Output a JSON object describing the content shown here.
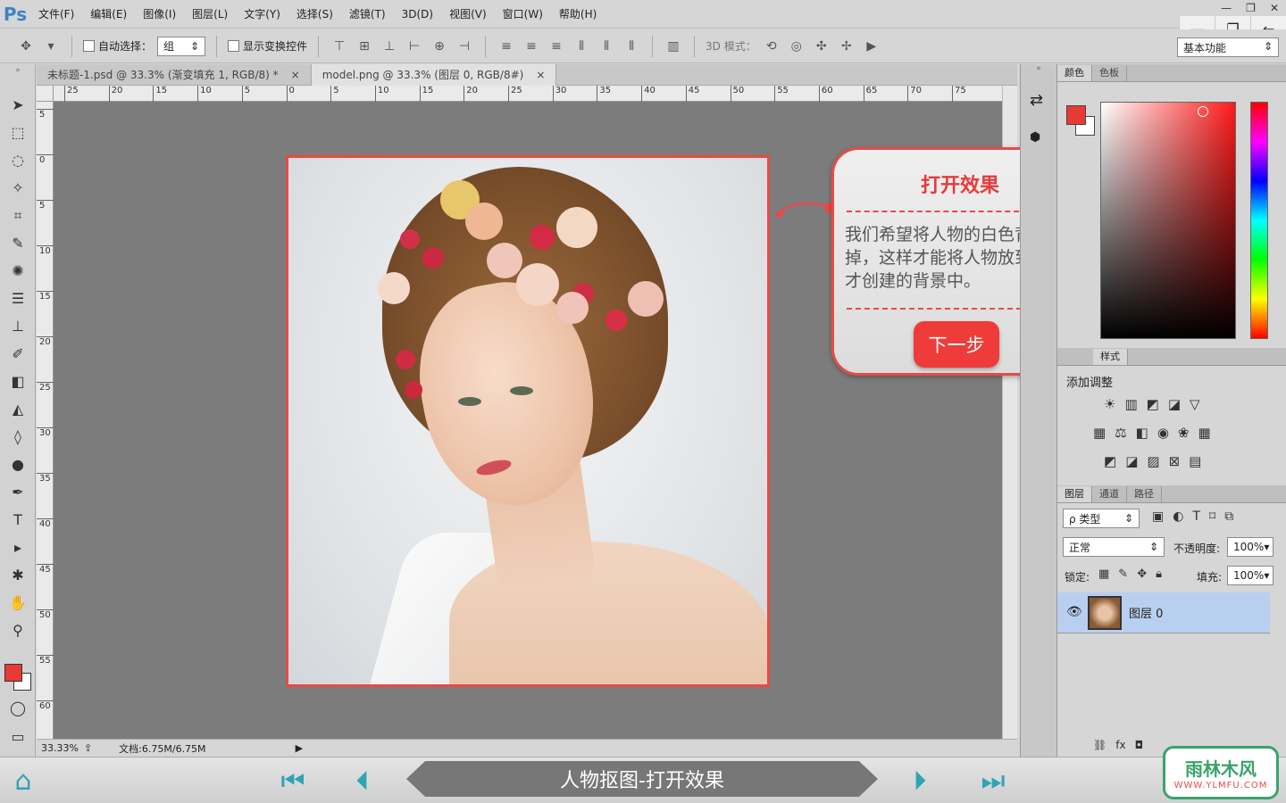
{
  "menubar": {
    "logo": "Ps",
    "items": [
      "文件(F)",
      "编辑(E)",
      "图像(I)",
      "图层(L)",
      "文字(Y)",
      "选择(S)",
      "滤镜(T)",
      "3D(D)",
      "视图(V)",
      "窗口(W)",
      "帮助(H)"
    ]
  },
  "options": {
    "auto_select_label": "自动选择：",
    "auto_select_value": "组",
    "show_transform_label": "显示变换控件",
    "mode_3d_label": "3D 模式：",
    "workspace": "基本功能"
  },
  "doc_tabs": [
    {
      "label": "未标题-1.psd @ 33.3% (渐变填充 1, RGB/8) *",
      "close": "×"
    },
    {
      "label": "model.png @ 33.3% (图层 0, RGB/8#)",
      "close": "×"
    }
  ],
  "ruler": {
    "h_ticks": [
      "25",
      "20",
      "15",
      "10",
      "5",
      "0",
      "5",
      "10",
      "15",
      "20",
      "25",
      "30",
      "35",
      "40",
      "45",
      "50",
      "55",
      "60",
      "65",
      "70",
      "75"
    ],
    "v_ticks": [
      "5",
      "0",
      "5",
      "10",
      "15",
      "20",
      "25",
      "30",
      "35",
      "40",
      "45",
      "50",
      "55",
      "60"
    ]
  },
  "status": {
    "zoom": "33.33%",
    "doc_size": "文档:6.75M/6.75M"
  },
  "callout": {
    "title": "打开效果",
    "body": "我们希望将人物的白色背景去掉，这样才能将人物放到我们刚才创建的背景中。",
    "button": "下一步"
  },
  "panels": {
    "color_tabs": [
      "颜色",
      "色板"
    ],
    "style_tabs": [
      "样式"
    ],
    "adjust_label": "添加调整",
    "layer_tabs": [
      "图层",
      "通道",
      "路径"
    ],
    "filter_kind": "ρ 类型",
    "blend_mode": "正常",
    "opacity_label": "不透明度:",
    "opacity_value": "100%",
    "lock_label": "锁定:",
    "fill_label": "填充:",
    "fill_value": "100%",
    "layer_name": "图层 0"
  },
  "nav": {
    "title": "人物抠图-打开效果"
  },
  "brand": {
    "main": "雨林木风",
    "sub": "WWW.YLMFU.COM"
  },
  "colors": {
    "accent_red": "#e84a47",
    "nav_teal": "#2fa4b4",
    "fg_color": "#e83a35"
  }
}
